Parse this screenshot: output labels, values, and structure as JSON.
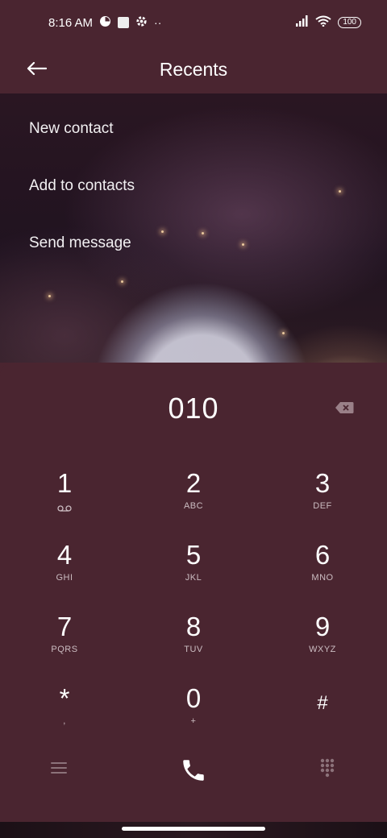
{
  "status_bar": {
    "time": "8:16 AM",
    "battery": "100",
    "icons": [
      "notification-icon",
      "square-icon",
      "settings-icon",
      "more-dots-icon",
      "signal-icon",
      "wifi-icon",
      "battery-icon"
    ]
  },
  "header": {
    "title": "Recents",
    "back_icon": "back-arrow-icon"
  },
  "menu": [
    {
      "label": "New contact"
    },
    {
      "label": "Add to contacts"
    },
    {
      "label": "Send message"
    }
  ],
  "dialer": {
    "number": "010",
    "keys": [
      {
        "digit": "1",
        "letters": ""
      },
      {
        "digit": "2",
        "letters": "ABC"
      },
      {
        "digit": "3",
        "letters": "DEF"
      },
      {
        "digit": "4",
        "letters": "GHI"
      },
      {
        "digit": "5",
        "letters": "JKL"
      },
      {
        "digit": "6",
        "letters": "MNO"
      },
      {
        "digit": "7",
        "letters": "PQRS"
      },
      {
        "digit": "8",
        "letters": "TUV"
      },
      {
        "digit": "9",
        "letters": "WXYZ"
      },
      {
        "digit": "*",
        "letters": ","
      },
      {
        "digit": "0",
        "letters": "+"
      },
      {
        "digit": "#",
        "letters": ""
      }
    ],
    "bottom_icons": [
      "menu-icon",
      "phone-call-icon",
      "dialpad-icon"
    ]
  },
  "colors": {
    "background": "#4a2530",
    "secondary_text": "#cbbcc1"
  }
}
